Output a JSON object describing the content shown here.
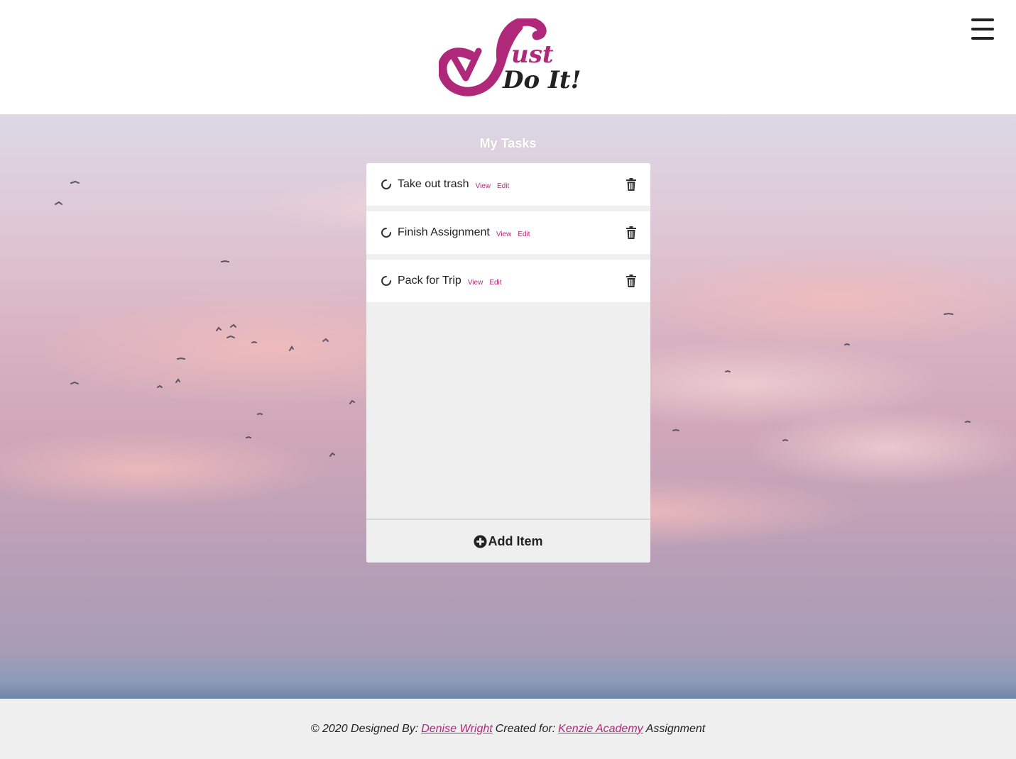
{
  "header": {
    "logo_text_line1": "ust",
    "logo_text_line2": "Do It!",
    "colors": {
      "brand": "#b0287a",
      "dark": "#222222"
    }
  },
  "main": {
    "title": "My Tasks",
    "tasks": [
      {
        "name": "Take out trash",
        "view_label": "View",
        "edit_label": "Edit"
      },
      {
        "name": "Finish Assignment",
        "view_label": "View",
        "edit_label": "Edit"
      },
      {
        "name": "Pack for Trip",
        "view_label": "View",
        "edit_label": "Edit"
      }
    ],
    "add_item_label": "Add Item",
    "icons": {
      "status": "spinner-icon",
      "delete": "trash-icon",
      "add": "plus-circle-icon",
      "menu": "hamburger-menu-icon"
    }
  },
  "footer": {
    "prefix": "© 2020 Designed By:",
    "designer": "Denise Wright",
    "created_for": "Created for:",
    "org": "Kenzie Academy",
    "suffix": "Assignment"
  }
}
